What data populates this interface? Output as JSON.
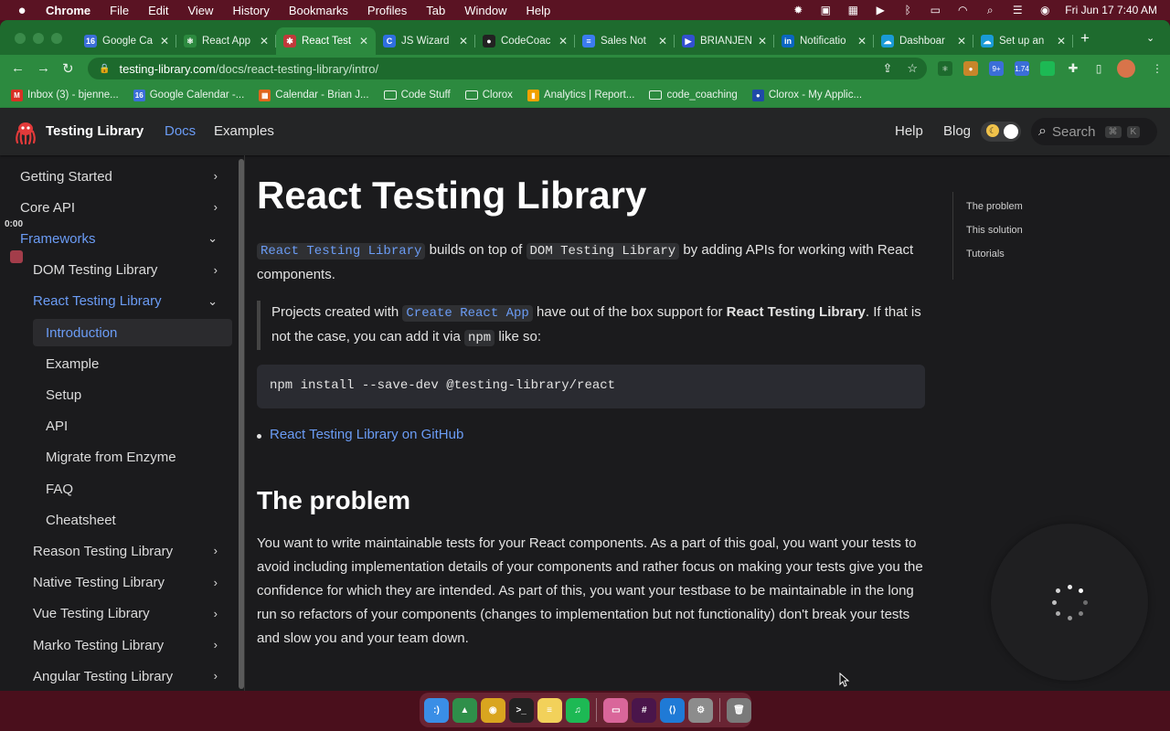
{
  "menubar": {
    "app": "Chrome",
    "items": [
      "File",
      "Edit",
      "View",
      "History",
      "Bookmarks",
      "Profiles",
      "Tab",
      "Window",
      "Help"
    ],
    "clock": "Fri Jun 17  7:40 AM"
  },
  "tabs": [
    {
      "label": "Google Ca",
      "icon": "google-calendar-icon",
      "color": "#3b6ed8",
      "glyph": "16"
    },
    {
      "label": "React App",
      "icon": "react-icon",
      "color": "#2c8a3f",
      "glyph": "⚛"
    },
    {
      "label": "React Test",
      "icon": "octopus-icon",
      "color": "#c03a3a",
      "glyph": "✱",
      "active": true
    },
    {
      "label": "JS Wizard",
      "icon": "js-wizard-icon",
      "color": "#2f6fe0",
      "glyph": "C"
    },
    {
      "label": "CodeCoac",
      "icon": "github-icon",
      "color": "#222222",
      "glyph": "●"
    },
    {
      "label": "Sales Not",
      "icon": "docs-icon",
      "color": "#3b7bf0",
      "glyph": "≡"
    },
    {
      "label": "BRIANJEN",
      "icon": "video-icon",
      "color": "#3250d0",
      "glyph": "▶"
    },
    {
      "label": "Notificatio",
      "icon": "linkedin-icon",
      "color": "#0a66c2",
      "glyph": "in"
    },
    {
      "label": "Dashboar",
      "icon": "salesforce-icon",
      "color": "#1a9bd7",
      "glyph": "☁"
    },
    {
      "label": "Set up an",
      "icon": "salesforce-icon",
      "color": "#1a9bd7",
      "glyph": "☁"
    }
  ],
  "address": {
    "domain": "testing-library.com",
    "path": "/docs/react-testing-library/intro/"
  },
  "bookmarks": [
    {
      "label": "Inbox (3) - bjenne...",
      "icon": "gmail-icon",
      "color": "#d93025",
      "glyph": "M"
    },
    {
      "label": "Google Calendar -...",
      "icon": "google-calendar-icon",
      "color": "#3b6ed8",
      "glyph": "16"
    },
    {
      "label": "Calendar - Brian J...",
      "icon": "microsoft-icon",
      "color": "#e0651c",
      "glyph": "▦"
    },
    {
      "label": "Code Stuff",
      "icon": "folder-icon",
      "folder": true
    },
    {
      "label": "Clorox",
      "icon": "folder-icon",
      "folder": true
    },
    {
      "label": "Analytics | Report...",
      "icon": "analytics-icon",
      "color": "#f2a100",
      "glyph": "▮"
    },
    {
      "label": "code_coaching",
      "icon": "folder-icon",
      "folder": true
    },
    {
      "label": "Clorox - My Applic...",
      "icon": "clorox-icon",
      "color": "#1f4aa8",
      "glyph": "●"
    }
  ],
  "site": {
    "brand": "Testing Library",
    "nav": {
      "docs": "Docs",
      "examples": "Examples",
      "help": "Help",
      "blog": "Blog"
    },
    "search": {
      "placeholder": "Search",
      "k1": "⌘",
      "k2": "K"
    }
  },
  "sidebar": {
    "timer": "0:00",
    "items": [
      {
        "label": "Getting Started",
        "level": 0,
        "chevron": "›"
      },
      {
        "label": "Core API",
        "level": 0,
        "chevron": "›"
      },
      {
        "label": "Frameworks",
        "level": 0,
        "chevron": "⌄",
        "active": true
      },
      {
        "label": "DOM Testing Library",
        "level": 1,
        "chevron": "›"
      },
      {
        "label": "React Testing Library",
        "level": 1,
        "chevron": "⌄",
        "active": true
      },
      {
        "label": "Introduction",
        "level": 2,
        "active": true,
        "selected": true
      },
      {
        "label": "Example",
        "level": 2
      },
      {
        "label": "Setup",
        "level": 2
      },
      {
        "label": "API",
        "level": 2
      },
      {
        "label": "Migrate from Enzyme",
        "level": 2
      },
      {
        "label": "FAQ",
        "level": 2
      },
      {
        "label": "Cheatsheet",
        "level": 2
      },
      {
        "label": "Reason Testing Library",
        "level": 1,
        "chevron": "›"
      },
      {
        "label": "Native Testing Library",
        "level": 1,
        "chevron": "›"
      },
      {
        "label": "Vue Testing Library",
        "level": 1,
        "chevron": "›"
      },
      {
        "label": "Marko Testing Library",
        "level": 1,
        "chevron": "›"
      },
      {
        "label": "Angular Testing Library",
        "level": 1,
        "chevron": "›"
      }
    ]
  },
  "content": {
    "title": "React Testing Library",
    "intro": {
      "code1": "React Testing Library",
      "text1": " builds on top of ",
      "code2": "DOM Testing Library",
      "text2": " by adding APIs for working with React components."
    },
    "quote": {
      "text1": "Projects created with ",
      "code1": "Create React App",
      "text2": " have out of the box support for ",
      "bold": "React Testing Library",
      "text3": ". If that is not the case, you can add it via ",
      "code2": "npm",
      "text4": " like so:"
    },
    "codeblock": "npm install --save-dev @testing-library/react",
    "github_link": "React Testing Library on GitHub",
    "h2": "The problem",
    "problem": "You want to write maintainable tests for your React components. As a part of this goal, you want your tests to avoid including implementation details of your components and rather focus on making your tests give you the confidence for which they are intended. As part of this, you want your testbase to be maintainable in the long run so refactors of your components (changes to implementation but not functionality) don't break your tests and slow you and your team down."
  },
  "toc": [
    "The problem",
    "This solution",
    "Tutorials"
  ],
  "dock": [
    {
      "icon": "finder-icon",
      "color": "#3a8ee6",
      "glyph": ":)"
    },
    {
      "icon": "rocket-icon",
      "color": "#2f8f4a",
      "glyph": "▲"
    },
    {
      "icon": "chrome-icon",
      "color": "#d9a51f",
      "glyph": "◉"
    },
    {
      "icon": "terminal-icon",
      "color": "#222222",
      "glyph": ">_"
    },
    {
      "icon": "notes-icon",
      "color": "#f2d15a",
      "glyph": "≡"
    },
    {
      "icon": "spotify-icon",
      "color": "#1db954",
      "glyph": "♫"
    },
    {
      "icon": "screen-icon",
      "color": "#d9669a",
      "glyph": "▭"
    },
    {
      "icon": "slack-icon",
      "color": "#4a154b",
      "glyph": "#"
    },
    {
      "icon": "vscode-icon",
      "color": "#1f7ad6",
      "glyph": "⟨⟩"
    },
    {
      "icon": "settings-icon",
      "color": "#8c8c8c",
      "glyph": "⚙"
    },
    {
      "icon": "trash-icon",
      "color": "#7a7a7a",
      "glyph": "🗑"
    }
  ],
  "colors": {
    "accent": "#6b9cf5",
    "chrome_tab": "#2c8a3f",
    "page_bg": "#1b1b1d"
  }
}
